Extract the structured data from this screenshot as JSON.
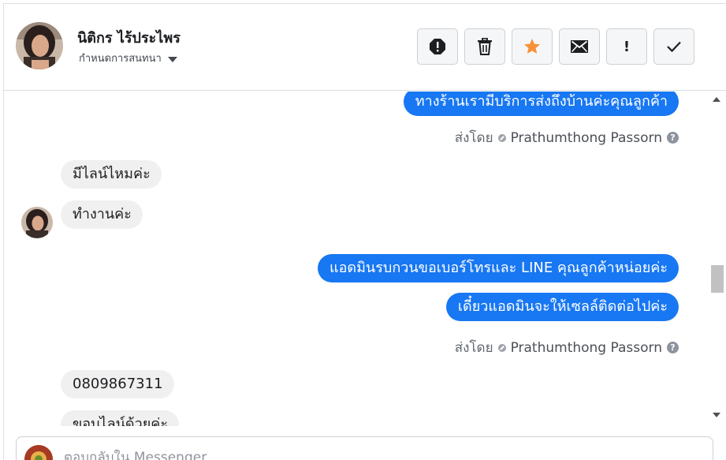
{
  "header": {
    "contact_name": "นิติกร ไร้ประไพร",
    "assign_label": "กำหนดการสนทนา"
  },
  "toolbar": {
    "buttons": [
      {
        "name": "spam",
        "icon": "octagon-alert-icon"
      },
      {
        "name": "delete",
        "icon": "trash-icon"
      },
      {
        "name": "star",
        "icon": "star-icon",
        "color": "#f7923b"
      },
      {
        "name": "unread",
        "icon": "envelope-icon"
      },
      {
        "name": "follow-up",
        "icon": "exclamation-icon",
        "glyph": "!"
      },
      {
        "name": "done",
        "icon": "checkmark-icon"
      }
    ]
  },
  "messages": {
    "m1": "ทางร้านเรามีบริการส่งถึงบ้านค่ะคุณลูกค้า",
    "sent_by_1": {
      "label": "ส่งโดย",
      "agent": "Prathumthong Passorn",
      "help": "?"
    },
    "m2": "มีไลน์ไหมค่ะ",
    "m3": "ทำงานค่ะ",
    "m4": "แอดมินรบกวนขอเบอร์โทรและ LINE คุณลูกค้าหน่อยค่ะ",
    "m5": "เดี๋ยวแอดมินจะให้เซลล์ติดต่อไปค่ะ",
    "sent_by_2": {
      "label": "ส่งโดย",
      "agent": "Prathumthong Passorn",
      "help": "?"
    },
    "m6": "0809867311",
    "m7": "ขอบไลน์ด้วยค่ะ"
  },
  "composer": {
    "placeholder": "ตอบกลับใน Messenger"
  },
  "colors": {
    "outgoing_bubble": "#1877f2",
    "incoming_bubble": "#f0f0f0",
    "star": "#f7923b"
  }
}
